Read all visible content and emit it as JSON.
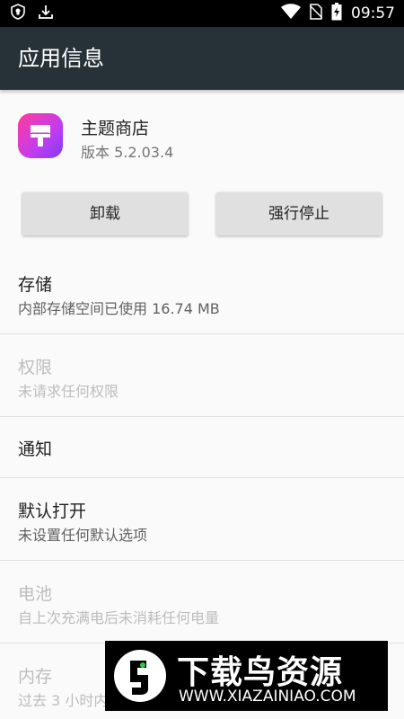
{
  "status_bar": {
    "time": "09:57",
    "icons_left": [
      "shield-icon",
      "download-icon"
    ],
    "icons_right": [
      "wifi-icon",
      "no-sim-icon",
      "battery-charging-icon"
    ]
  },
  "app_bar": {
    "title": "应用信息"
  },
  "app": {
    "name": "主题商店",
    "version": "版本 5.2.03.4"
  },
  "buttons": {
    "uninstall": "卸载",
    "force_stop": "强行停止"
  },
  "prefs": {
    "storage": {
      "title": "存储",
      "summary": "内部存储空间已使用 16.74 MB"
    },
    "permissions": {
      "title": "权限",
      "summary": "未请求任何权限"
    },
    "notifications": {
      "title": "通知"
    },
    "open_by_default": {
      "title": "默认打开",
      "summary": "未设置任何默认选项"
    },
    "battery": {
      "title": "电池",
      "summary": "自上次充满电后未消耗任何电量"
    },
    "memory": {
      "title": "内存",
      "summary": "过去 3 小时内"
    }
  },
  "watermark": {
    "text": "下载鸟资源",
    "url": "WWW.XIAZAINIAO.COM"
  },
  "colors": {
    "status_bar": "#000000",
    "app_bar": "#263238",
    "background": "#fafafa",
    "button": "#e0e0e0",
    "app_icon_gradient": [
      "#ff3b9a",
      "#7a3cf5"
    ]
  }
}
